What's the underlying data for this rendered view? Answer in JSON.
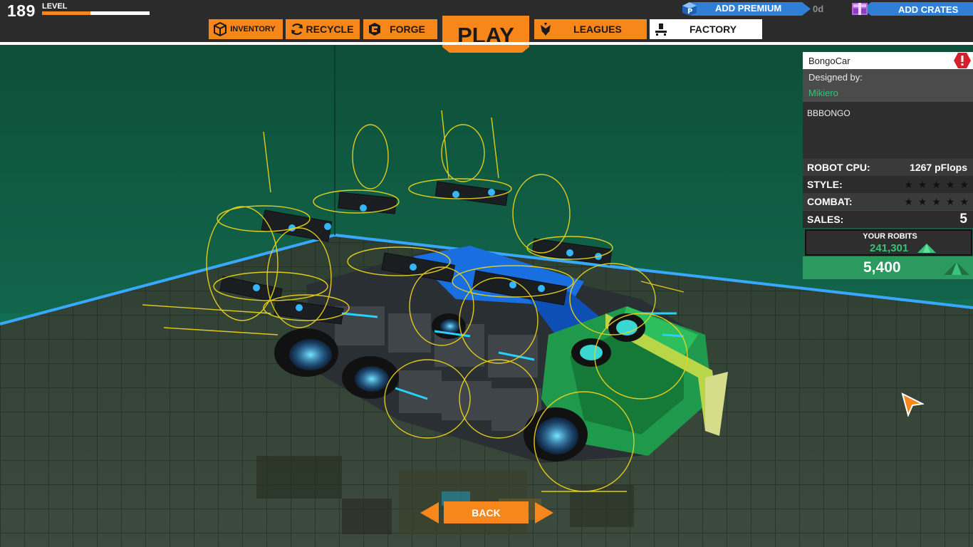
{
  "player": {
    "level": "189",
    "level_label": "LEVEL",
    "level_progress": 0.45
  },
  "header": {
    "premium_label": "ADD PREMIUM",
    "premium_days": "0d",
    "crates_label": "ADD CRATES"
  },
  "nav": {
    "inventory": "INVENTORY",
    "recycle": "RECYCLE",
    "forge": "FORGE",
    "play": "PLAY",
    "leagues": "LEAGUES",
    "factory": "FACTORY",
    "active_tab": "FACTORY"
  },
  "robot": {
    "name": "BongoCar",
    "designed_by_label": "Designed by:",
    "designer": "Mikiero",
    "description": "BBBONGO",
    "cpu_label": "ROBOT CPU:",
    "cpu_value": "1267 pFlops",
    "style_label": "STYLE:",
    "style_rating": 0,
    "combat_label": "COMBAT:",
    "combat_rating": 0,
    "sales_label": "SALES:",
    "sales_value": "5",
    "your_robits_label": "YOUR ROBITS",
    "your_robits_value": "241,301",
    "price": "5,400"
  },
  "footer": {
    "back_label": "BACK"
  },
  "colors": {
    "accent_orange": "#f7861b",
    "robits_green": "#38c27a",
    "price_green": "#2a9a5f",
    "premium_blue": "#2f7fd6",
    "warning_red": "#d4202a",
    "bay_green": "#0f5540",
    "bay_edge_blue": "#39a9ff",
    "floor_grid": "#3a4a3a",
    "attachment_yellow": "#e8d21c"
  },
  "icons": [
    "inventory-cube-icon",
    "recycle-icon",
    "forge-icon",
    "leagues-icon",
    "factory-icon",
    "premium-icon",
    "crate-icon",
    "warning-icon",
    "robits-icon",
    "cursor-icon"
  ]
}
